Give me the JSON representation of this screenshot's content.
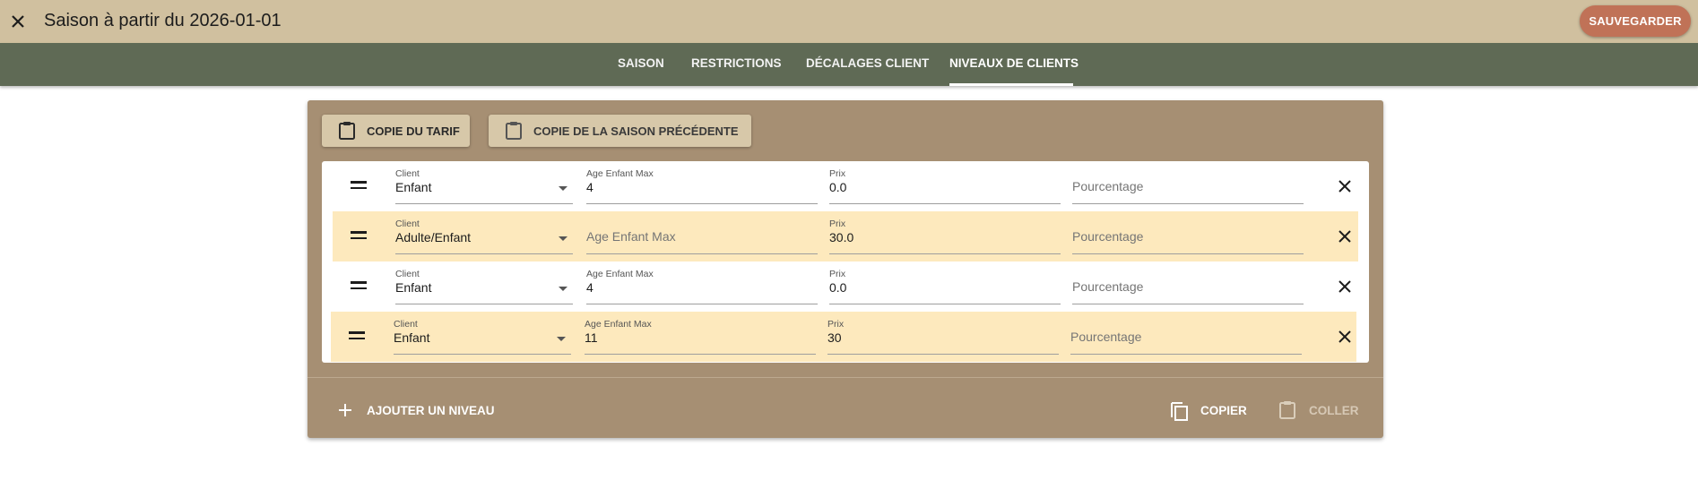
{
  "header": {
    "title": "Saison à partir du 2026-01-01",
    "close_icon": "close-icon",
    "save_label": "SAUVEGARDER"
  },
  "tabs": [
    {
      "label": "SAISON",
      "active": false
    },
    {
      "label": "RESTRICTIONS",
      "active": false
    },
    {
      "label": "DÉCALAGES CLIENT",
      "active": false
    },
    {
      "label": "NIVEAUX DE CLIENTS",
      "active": true
    }
  ],
  "toolbar": {
    "copy_tariff_label": "COPIE DU TARIF",
    "copy_prev_season_label": "COPIE DE LA SAISON PRÉCÉDENTE",
    "icon": "clipboard-icon"
  },
  "labels": {
    "client": "Client",
    "age": "Age Enfant Max",
    "prix": "Prix",
    "pourcentage": "Pourcentage"
  },
  "levels": [
    {
      "client": "Enfant",
      "age": "4",
      "prix": "0.0",
      "pourcentage": "",
      "highlighted": false
    },
    {
      "client": "Adulte/Enfant",
      "age": "",
      "prix": "30.0",
      "pourcentage": "",
      "highlighted": true
    },
    {
      "client": "Enfant",
      "age": "4",
      "prix": "0.0",
      "pourcentage": "",
      "highlighted": false
    },
    {
      "client": "Enfant",
      "age": "11",
      "prix": "30",
      "pourcentage": "",
      "highlighted": true
    }
  ],
  "footer": {
    "add_level_label": "AJOUTER UN NIVEAU",
    "copy_label": "COPIER",
    "paste_label": "COLLER",
    "paste_disabled": true
  },
  "colors": {
    "topbar": "#d0c09f",
    "tabbar": "#5f6a55",
    "card": "#a68f73",
    "save_button": "#c07257",
    "row_highlight": "#fde9bd"
  }
}
